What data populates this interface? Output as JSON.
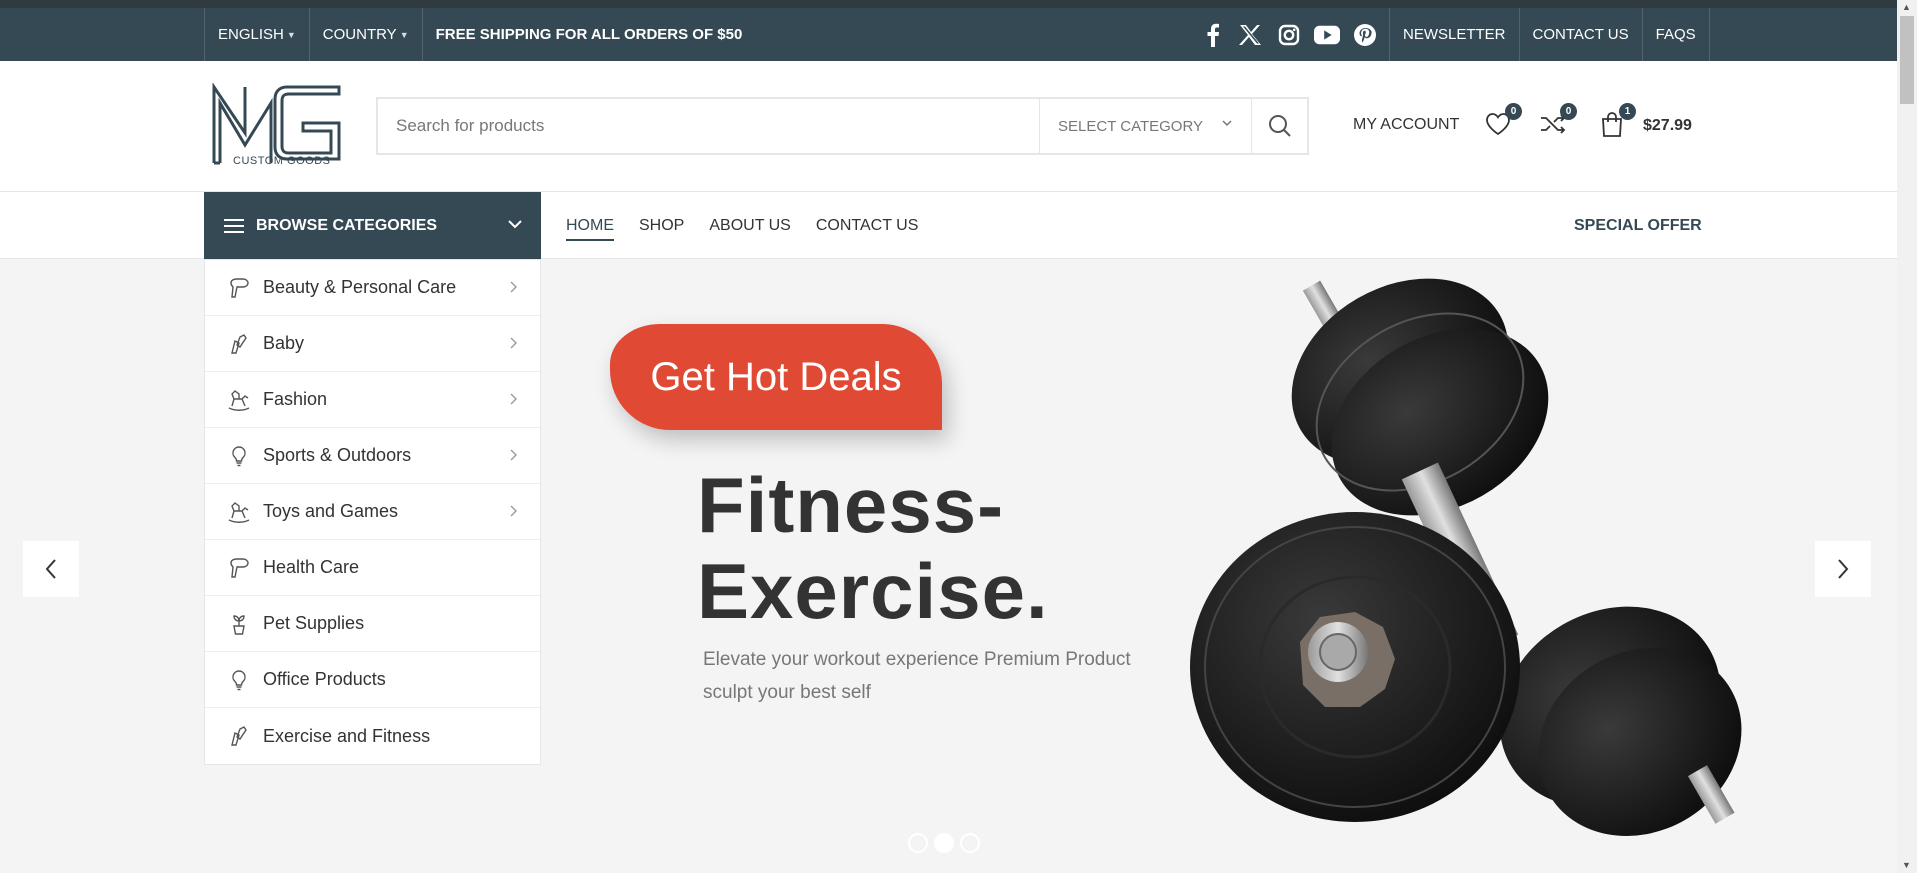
{
  "topbar": {
    "language": "ENGLISH",
    "country": "COUNTRY",
    "shipping": "FREE SHIPPING FOR ALL ORDERS OF $50",
    "social": [
      "facebook-icon",
      "x-icon",
      "instagram-icon",
      "youtube-icon",
      "pinterest-icon"
    ],
    "links": [
      "NEWSLETTER",
      "CONTACT US",
      "FAQS"
    ]
  },
  "header": {
    "logo_text": "CUSTOM GOODS",
    "logo_letters": "MG",
    "search_placeholder": "Search for products",
    "select_category": "SELECT CATEGORY",
    "account": "MY ACCOUNT",
    "wishlist_count": "0",
    "compare_count": "0",
    "cart_count": "1",
    "cart_total": "$27.99"
  },
  "nav": {
    "browse": "BROWSE CATEGORIES",
    "items": [
      "HOME",
      "SHOP",
      "ABOUT US",
      "CONTACT US"
    ],
    "special": "SPECIAL OFFER"
  },
  "categories": [
    {
      "label": "Beauty & Personal Care",
      "icon": "hairdryer-icon",
      "has_sub": true
    },
    {
      "label": "Baby",
      "icon": "tools-icon",
      "has_sub": true
    },
    {
      "label": "Fashion",
      "icon": "rocking-horse-icon",
      "has_sub": true
    },
    {
      "label": "Sports & Outdoors",
      "icon": "lightbulb-icon",
      "has_sub": true
    },
    {
      "label": "Toys and Games",
      "icon": "rocking-horse-icon",
      "has_sub": true
    },
    {
      "label": "Health Care",
      "icon": "hairdryer-icon",
      "has_sub": false
    },
    {
      "label": "Pet Supplies",
      "icon": "plant-icon",
      "has_sub": false
    },
    {
      "label": "Office Products",
      "icon": "lightbulb-icon",
      "has_sub": false
    },
    {
      "label": "Exercise and Fitness",
      "icon": "tools-icon",
      "has_sub": false
    }
  ],
  "hero": {
    "badge": "Get Hot Deals",
    "title_line1": "Fitness-",
    "title_line2": "Exercise.",
    "subtitle": "Elevate your workout experience Premium Product sculpt your best self",
    "slides": 3,
    "active_slide": 2
  },
  "colors": {
    "primary": "#354954",
    "accent": "#e04a35",
    "hero_bg": "#f4f4f4"
  }
}
